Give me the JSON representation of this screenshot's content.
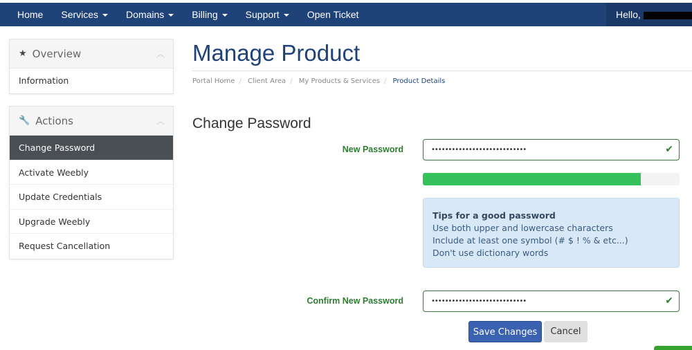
{
  "nav": {
    "items": [
      {
        "label": "Home",
        "caret": false
      },
      {
        "label": "Services",
        "caret": true
      },
      {
        "label": "Domains",
        "caret": true
      },
      {
        "label": "Billing",
        "caret": true
      },
      {
        "label": "Support",
        "caret": true
      },
      {
        "label": "Open Ticket",
        "caret": false
      }
    ],
    "greeting": "Hello,"
  },
  "sidebar": {
    "overview": {
      "title": "Overview",
      "items": [
        "Information"
      ]
    },
    "actions": {
      "title": "Actions",
      "items": [
        "Change Password",
        "Activate Weebly",
        "Update Credentials",
        "Upgrade Weebly",
        "Request Cancellation"
      ],
      "active": 0
    }
  },
  "page": {
    "title": "Manage Product",
    "breadcrumb": [
      "Portal Home",
      "Client Area",
      "My Products & Services",
      "Product Details"
    ]
  },
  "form": {
    "heading": "Change Password",
    "new_label": "New Password",
    "new_value": "••••••••••••••••••••••••••••",
    "strength_percent": 85,
    "confirm_label": "Confirm New Password",
    "confirm_value": "••••••••••••••••••••••••••••",
    "tips": {
      "title": "Tips for a good password",
      "lines": [
        "Use both upper and lowercase characters",
        "Include at least one symbol (# $ ! % & etc...)",
        "Don't use dictionary words"
      ]
    },
    "save": "Save Changes",
    "cancel": "Cancel"
  },
  "colors": {
    "nav": "#1f4279",
    "success": "#2e7d32",
    "strength": "#35c15b",
    "primary": "#3a62b0"
  }
}
